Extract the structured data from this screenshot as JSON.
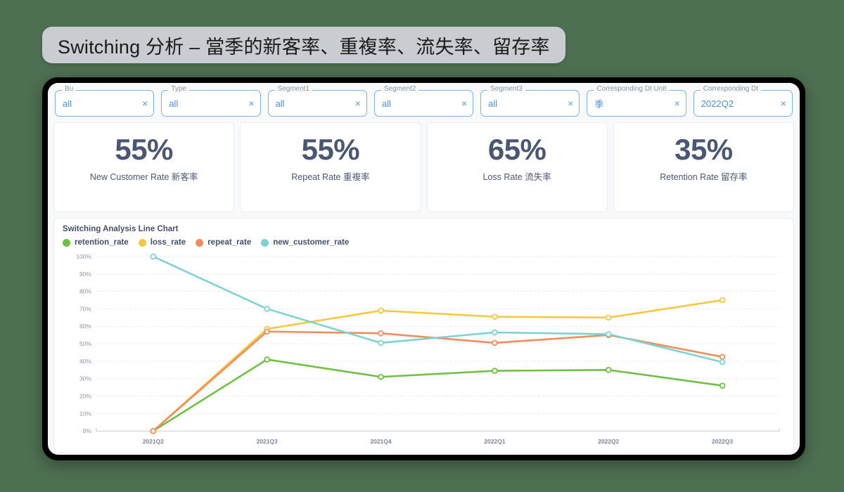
{
  "page_title": "Switching 分析 – 當季的新客率、重複率、流失率、留存率",
  "filters": [
    {
      "label": "Bu",
      "value": "all",
      "clear_icon": "×"
    },
    {
      "label": "Type",
      "value": "all",
      "clear_icon": "×"
    },
    {
      "label": "Segment1",
      "value": "all",
      "clear_icon": "×"
    },
    {
      "label": "Segment2",
      "value": "all",
      "clear_icon": "×"
    },
    {
      "label": "Segment3",
      "value": "all",
      "clear_icon": "×"
    },
    {
      "label": "Corresponding Dt Unit",
      "value": "季",
      "clear_icon": "×"
    },
    {
      "label": "Corresponding Dt",
      "value": "2022Q2",
      "clear_icon": "×"
    }
  ],
  "kpis": [
    {
      "value": "55%",
      "caption": "New Customer Rate 新客率"
    },
    {
      "value": "55%",
      "caption": "Repeat Rate 重複率"
    },
    {
      "value": "65%",
      "caption": "Loss Rate 流失率"
    },
    {
      "value": "35%",
      "caption": "Retention Rate 留存率"
    }
  ],
  "colors": {
    "retention_rate": "#6fbf44",
    "loss_rate": "#f5c842",
    "repeat_rate": "#ef8e5c",
    "new_customer_rate": "#7fd2d2",
    "kpi_text": "#4b5772",
    "accent_blue": "#4a90d9",
    "background": "#4e7052",
    "title_pill": "#c9cdd1"
  },
  "chart_data": {
    "type": "line",
    "title": "Switching Analysis Line Chart",
    "xlabel": "",
    "ylabel": "",
    "ylim": [
      0,
      100
    ],
    "yticks": [
      "0%",
      "10%",
      "20%",
      "30%",
      "40%",
      "50%",
      "60%",
      "70%",
      "80%",
      "90%",
      "100%"
    ],
    "grid": true,
    "legend_position": "top-left",
    "categories": [
      "2021Q2",
      "2021Q3",
      "2021Q4",
      "2022Q1",
      "2022Q2",
      "2022Q3"
    ],
    "series": [
      {
        "name": "retention_rate",
        "color": "#6fbf44",
        "values": [
          0,
          41,
          31,
          34.5,
          35,
          26
        ]
      },
      {
        "name": "loss_rate",
        "color": "#f5c842",
        "values": [
          0,
          58.5,
          69,
          65.5,
          65,
          75
        ]
      },
      {
        "name": "repeat_rate",
        "color": "#ef8e5c",
        "values": [
          0,
          57,
          56,
          50.5,
          55,
          42.5
        ]
      },
      {
        "name": "new_customer_rate",
        "color": "#7fd2d2",
        "values": [
          100,
          70,
          50.5,
          56.5,
          55.5,
          39.5
        ]
      }
    ]
  }
}
